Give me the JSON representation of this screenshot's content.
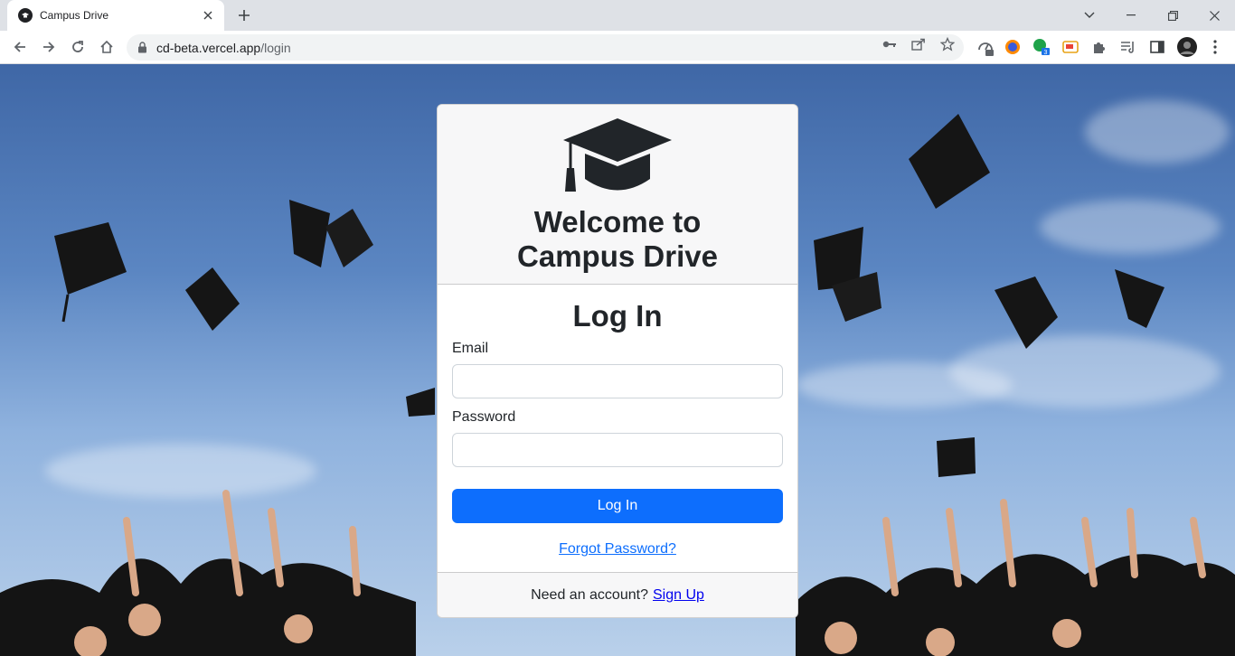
{
  "browser": {
    "tab_title": "Campus Drive",
    "url_host": "cd-beta.vercel.app",
    "url_path": "/login",
    "extension_badges": {
      "ext1": "...",
      "ext2": "3"
    }
  },
  "card": {
    "brand_title": "Welcome to Campus Drive",
    "heading": "Log In",
    "email_label": "Email",
    "email_value": "",
    "password_label": "Password",
    "password_value": "",
    "submit_label": "Log In",
    "forgot_link": "Forgot Password?",
    "footer_text": "Need an account?",
    "signup_link": "Sign Up"
  },
  "colors": {
    "primary": "#0d6efd",
    "text": "#212529",
    "card_header_bg": "#f7f7f8"
  }
}
